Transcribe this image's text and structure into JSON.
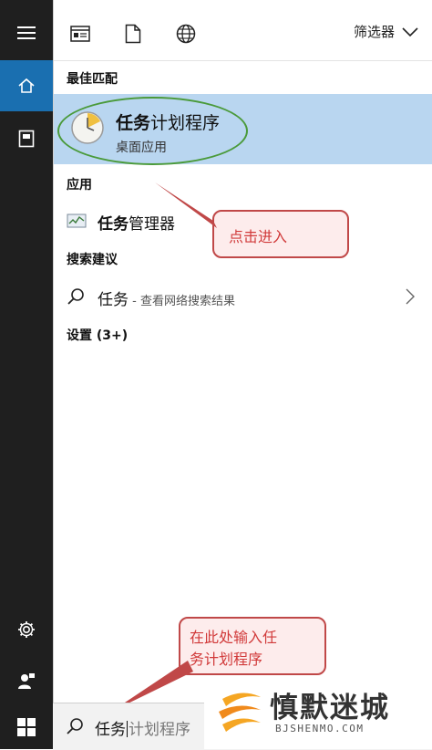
{
  "topbar": {
    "filter_label": "筛选器"
  },
  "sections": {
    "best_match": "最佳匹配",
    "apps": "应用",
    "search_suggestions": "搜索建议",
    "settings": "设置 (3+)"
  },
  "best_match_item": {
    "title_bold": "任务",
    "title_rest": "计划程序",
    "subtitle": "桌面应用"
  },
  "app_item": {
    "title_bold": "任务",
    "title_rest": "管理器"
  },
  "suggestion_item": {
    "term": "任务",
    "detail": " - 查看网络搜索结果"
  },
  "callouts": {
    "click_enter": "点击进入",
    "type_here_line1": "在此处输入任",
    "type_here_line2": "务计划程序"
  },
  "search": {
    "typed": "任务",
    "suggested_rest": "计划程序"
  },
  "watermark": {
    "text": "慎默迷城",
    "url": "BJSHENMO.COM"
  },
  "colors": {
    "sidebar": "#1f1f1f",
    "accent": "#1a6fb0",
    "selected_row": "#b9d6f0",
    "annotation_red": "#c04848",
    "highlight_green": "#4a9a3a"
  }
}
